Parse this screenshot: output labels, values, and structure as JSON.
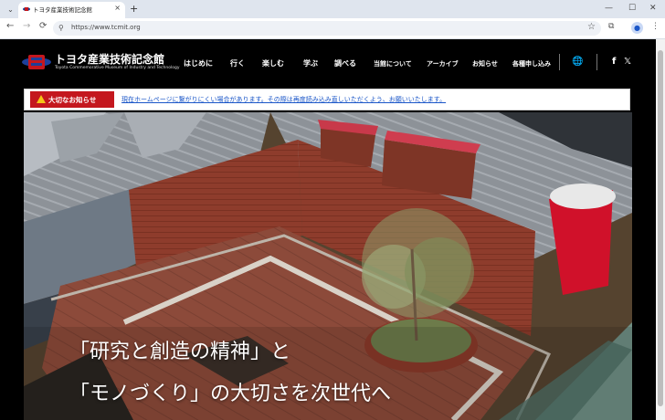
{
  "browser": {
    "tab_title": "トヨタ産業技術記念館",
    "tab_close": "×",
    "new_tab": "+",
    "url": "https://www.tcmit.org",
    "tab_list": "⌄",
    "back": "←",
    "forward": "→",
    "reload": "⟳",
    "site_info": "⚲",
    "star": "☆",
    "extensions": "⧉",
    "sidepanel": "▯",
    "menu": "⋮",
    "minimize": "—",
    "maximize": "☐",
    "close": "✕",
    "profile": "●"
  },
  "site": {
    "logo_ja": "トヨタ産業技術記念館",
    "logo_en": "Toyota Commemorative Museum of Industry and Technology",
    "nav": [
      "はじめに",
      "行く",
      "楽しむ",
      "学ぶ",
      "調べる"
    ],
    "nav_small": [
      "当館について",
      "アーカイブ",
      "お知らせ",
      "各種申し込み"
    ],
    "globe": "🌐",
    "facebook": "f",
    "x": "𝕏"
  },
  "notice": {
    "label": "大切なお知らせ",
    "message": "現在ホームページに繋がりにくい場合があります。その際は再度読み込み直しいただくよう、お願いいたします。"
  },
  "hero": {
    "line1": "「研究と創造の精神」と",
    "line2": "「モノづくり」の大切さを次世代へ"
  },
  "colors": {
    "brand_red": "#c4171e",
    "warn_yellow": "#f5c518",
    "link_blue": "#1a56c8"
  }
}
